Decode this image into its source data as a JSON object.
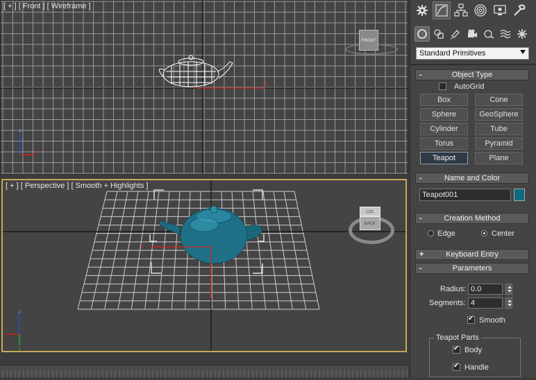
{
  "viewports": {
    "front": {
      "label": "[ + ] [ Front ] [ Wireframe ]",
      "viewcube_label": "FRONT"
    },
    "perspective": {
      "label": "[ + ] [ Perspective ] [ Smooth + Highlights ]",
      "viewcube_top": "LOL",
      "viewcube_front": "BACK"
    }
  },
  "command_panel": {
    "tabs": [
      "create-icon",
      "modify-icon",
      "hierarchy-icon",
      "motion-icon",
      "display-icon",
      "utilities-icon"
    ],
    "subtabs": [
      "geometry-icon",
      "shapes-icon",
      "lights-icon",
      "cameras-icon",
      "helpers-icon",
      "spacewarps-icon",
      "systems-icon"
    ],
    "category_dropdown": "Standard Primitives",
    "object_type": {
      "title": "Object Type",
      "autogrid_label": "AutoGrid",
      "buttons": [
        "Box",
        "Cone",
        "Sphere",
        "GeoSphere",
        "Cylinder",
        "Tube",
        "Torus",
        "Pyramid",
        "Teapot",
        "Plane"
      ],
      "active": "Teapot"
    },
    "name_and_color": {
      "title": "Name and Color",
      "name_value": "Teapot001",
      "color": "#0e6a80"
    },
    "creation_method": {
      "title": "Creation Method",
      "options": [
        "Edge",
        "Center"
      ],
      "selected": "Center"
    },
    "keyboard_entry": {
      "title": "Keyboard Entry",
      "sign": "+"
    },
    "parameters": {
      "title": "Parameters",
      "radius_label": "Radius:",
      "radius_value": "0.0",
      "segments_label": "Segments:",
      "segments_value": "4",
      "smooth_label": "Smooth",
      "teapot_parts_label": "Teapot Parts",
      "body_label": "Body",
      "handle_label": "Handle"
    },
    "minus_sign": "-"
  },
  "colors": {
    "accent_viewport_border": "#c8a95a",
    "teapot": "#1f6f88",
    "grid": "#a0a0a0"
  }
}
